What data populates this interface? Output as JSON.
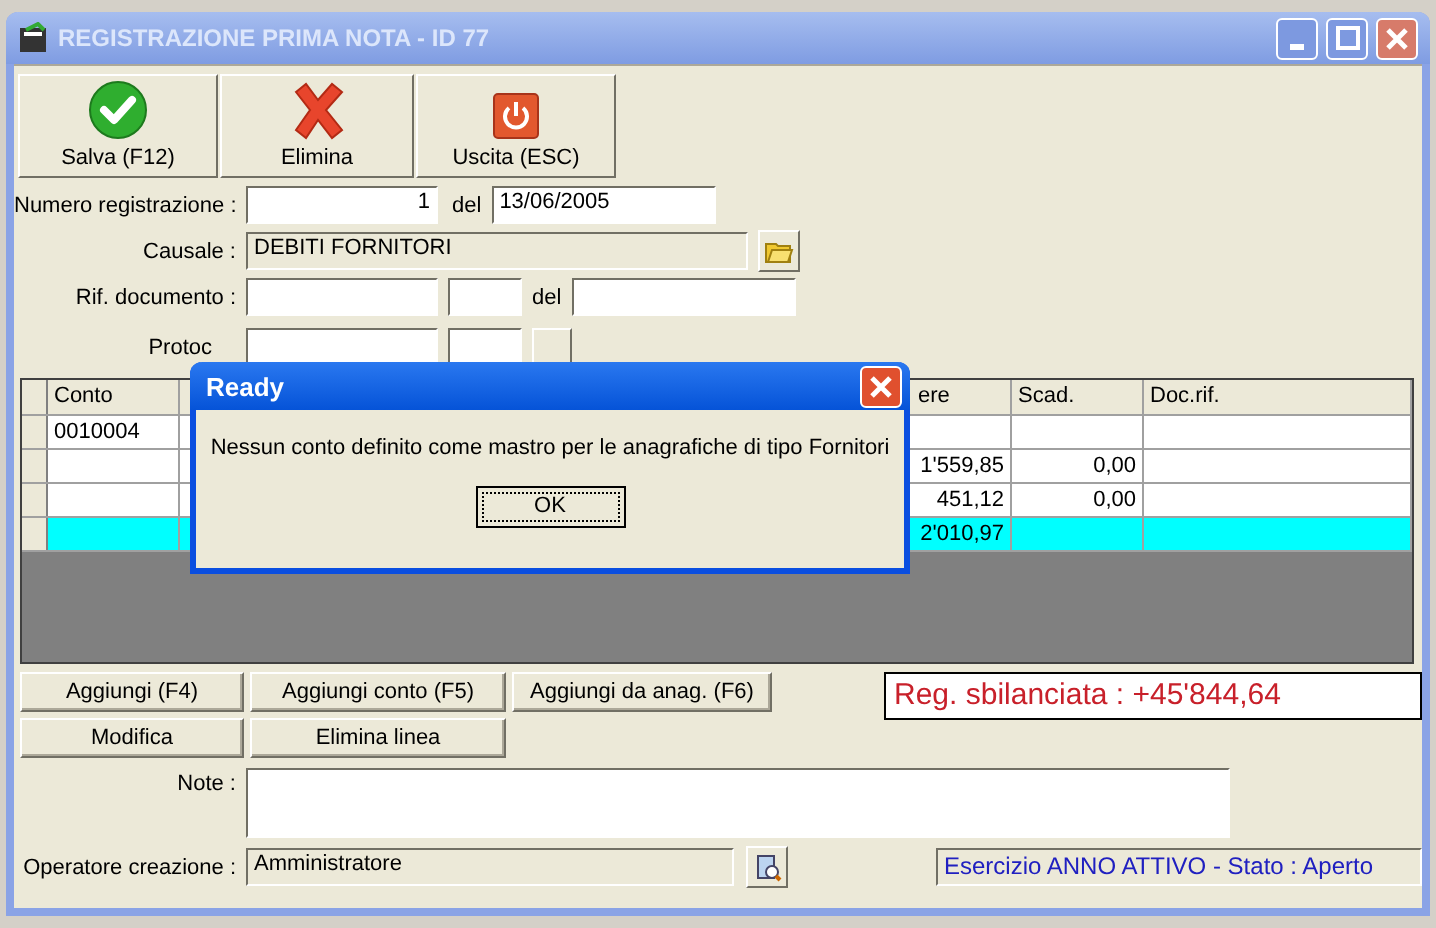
{
  "window": {
    "title": "REGISTRAZIONE PRIMA NOTA - ID 77"
  },
  "toolbar": [
    {
      "kind": "save",
      "label": "Salva (F12)"
    },
    {
      "kind": "delete",
      "label": "Elimina"
    },
    {
      "kind": "exit",
      "label": "Uscita (ESC)"
    }
  ],
  "form": {
    "numero": {
      "label": "Numero registrazione :",
      "value": "1",
      "del_label": "del",
      "date": "13/06/2005"
    },
    "causale": {
      "label": "Causale :",
      "value": "DEBITI FORNITORI"
    },
    "rif": {
      "label": "Rif. documento :",
      "del_label": "del"
    },
    "protocollo": {
      "label": "Protoc"
    }
  },
  "grid": {
    "columns": [
      "Conto",
      "ere",
      "Scad.",
      "Doc.rif."
    ],
    "rows": [
      {
        "selected": false,
        "cells": [
          "0010004",
          null,
          null,
          null
        ]
      },
      {
        "selected": false,
        "cells": [
          null,
          "1'559,85",
          "0,00",
          null
        ]
      },
      {
        "selected": false,
        "cells": [
          null,
          "451,12",
          "0,00",
          null
        ]
      },
      {
        "selected": true,
        "cells": [
          null,
          "2'010,97",
          null,
          null
        ]
      }
    ]
  },
  "dialog": {
    "title": "Ready",
    "message": "Nessun conto definito come mastro per le anagrafiche di tipo Fornitori",
    "button": "OK"
  },
  "actions": [
    [
      "Aggiungi (F4)",
      "Aggiungi conto (F5)",
      "Aggiungi da anag. (F6)"
    ],
    [
      "Modifica",
      "Elimina linea"
    ]
  ],
  "balance": "Reg. sbilanciata : +45'844,64",
  "note": {
    "label": "Note :"
  },
  "operatore": {
    "label": "Operatore creazione :",
    "value": "Amministratore"
  },
  "status": "Esercizio ANNO ATTIVO - Stato : Aperto"
}
